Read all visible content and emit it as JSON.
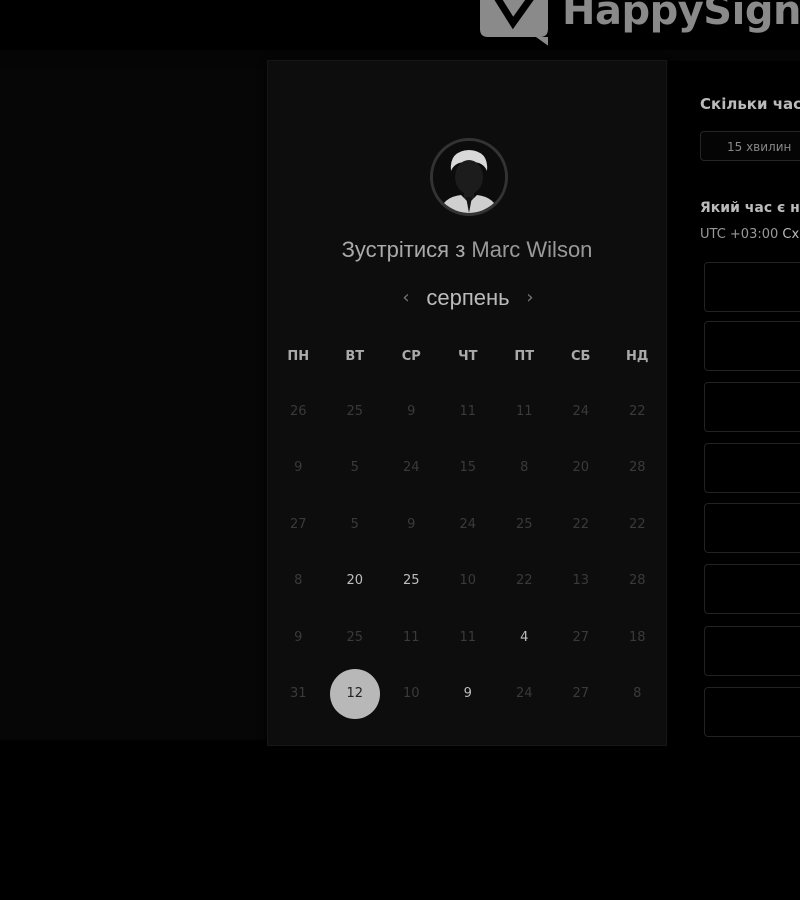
{
  "brand": {
    "name": "HappySign"
  },
  "host": {
    "title_prefix": "Зустрітися з",
    "name": "Marc Wilson"
  },
  "calendar": {
    "month": "серпень",
    "prev_icon": "‹",
    "next_icon": "›",
    "weekdays": [
      "ПН",
      "ВТ",
      "СР",
      "ЧТ",
      "ПТ",
      "СБ",
      "НД"
    ],
    "weeks": [
      [
        "26",
        "25",
        "9",
        "11",
        "11",
        "24",
        "22"
      ],
      [
        "9",
        "5",
        "24",
        "15",
        "8",
        "20",
        "28"
      ],
      [
        "27",
        "5",
        "9",
        "24",
        "25",
        "22",
        "22"
      ],
      [
        "8",
        "20",
        "25",
        "10",
        "22",
        "13",
        "28"
      ],
      [
        "9",
        "25",
        "11",
        "11",
        "4",
        "27",
        "18"
      ],
      [
        "31",
        "12",
        "10",
        "9",
        "24",
        "27",
        "8"
      ]
    ],
    "available": [
      [
        3,
        1
      ],
      [
        3,
        2
      ],
      [
        4,
        4
      ],
      [
        5,
        3
      ]
    ],
    "selected": [
      5,
      1
    ]
  },
  "duration": {
    "question": "Скільки часу",
    "option": "15 хвилин"
  },
  "time": {
    "question": "Який час є на",
    "tz_offset": "UTC +03:00",
    "tz_zone": "Сх"
  },
  "colors": {
    "selected_day_bg": "#b8b8b8",
    "available_day": "#bdbdbd",
    "unavailable_day": "#3a3a3a"
  }
}
